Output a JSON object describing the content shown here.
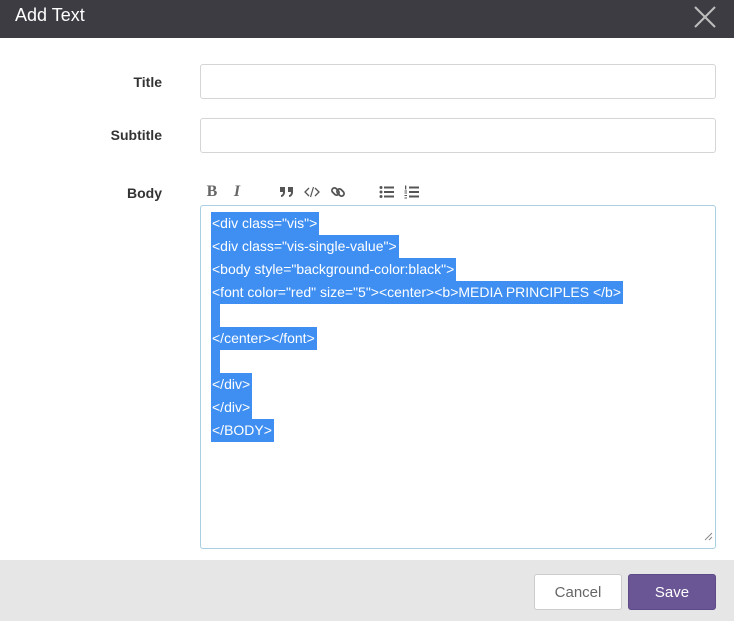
{
  "dialog": {
    "title": "Add Text"
  },
  "form": {
    "title_label": "Title",
    "title_value": "",
    "subtitle_label": "Subtitle",
    "subtitle_value": "",
    "body_label": "Body"
  },
  "toolbar": {
    "bold": "B",
    "italic": "I",
    "icons": [
      "quote-icon",
      "code-icon",
      "link-icon",
      "bullet-list-icon",
      "numbered-list-icon"
    ]
  },
  "body": {
    "lines": [
      "<div class=\"vis\">",
      "<div class=\"vis-single-value\">",
      "<body style=\"background-color:black\">",
      "<font color=\"red\" size=\"5\"><center><b>MEDIA PRINCIPLES  </b>",
      "",
      "</center></font>",
      "",
      "</div>",
      "</div>",
      "</BODY>"
    ],
    "selection_color": "#3f8ff2"
  },
  "footer": {
    "cancel_label": "Cancel",
    "save_label": "Save",
    "save_color": "#6a5595"
  }
}
